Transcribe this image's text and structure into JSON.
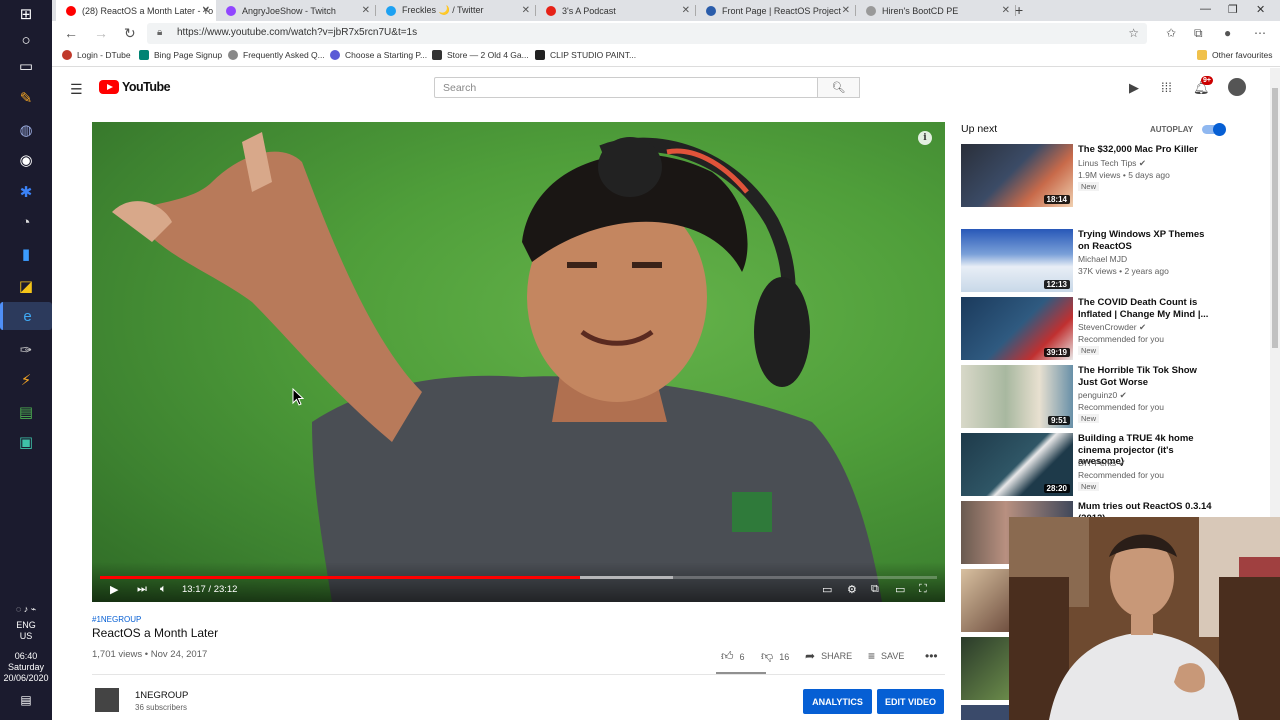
{
  "browser": {
    "tabs": [
      {
        "title": "(28) ReactOS a Month Later - Yo",
        "color": "#ff0000",
        "active": true
      },
      {
        "title": "AngryJoeShow - Twitch",
        "color": "#9146ff",
        "active": false
      },
      {
        "title": "Freckles 🌙 / Twitter",
        "color": "#1da1f2",
        "active": false
      },
      {
        "title": "3's A Podcast",
        "color": "#e62117",
        "active": false
      },
      {
        "title": "Front Page | ReactOS Project",
        "color": "#2a5caa",
        "active": false
      },
      {
        "title": "Hiren's BootCD PE",
        "color": "#999999",
        "active": false
      }
    ],
    "url": "https://www.youtube.com/watch?v=jbR7x5rcn7U&t=1s",
    "bookmarks": [
      {
        "label": "Login - DTube",
        "color": "#c0392b"
      },
      {
        "label": "Bing Page Signup",
        "color": "#008373"
      },
      {
        "label": "Frequently Asked Q...",
        "color": "#888888"
      },
      {
        "label": "Choose a Starting P...",
        "color": "#5b5bd6"
      },
      {
        "label": "Store — 2 Old 4 Ga...",
        "color": "#333333"
      },
      {
        "label": "CLIP STUDIO PAINT...",
        "color": "#222222"
      }
    ],
    "other_favourites": "Other favourites"
  },
  "taskbar": {
    "lang": "ENG",
    "region": "US",
    "time": "06:40",
    "day": "Saturday",
    "date": "20/06/2020"
  },
  "youtube": {
    "logo_text": "YouTube",
    "search_placeholder": "Search",
    "notification_count": "9+"
  },
  "player": {
    "timecode": "13:17 / 23:12",
    "played_fraction": 0.573,
    "buffered_fraction": 0.685
  },
  "video": {
    "hashtag": "#1NEGROUP",
    "title": "ReactOS a Month Later",
    "views_date": "1,701 views • Nov 24, 2017",
    "likes": "6",
    "dislikes": "16",
    "share_label": "SHARE",
    "save_label": "SAVE",
    "channel_name": "1NEGROUP",
    "channel_subs": "36 subscribers",
    "analytics_label": "ANALYTICS",
    "edit_label": "EDIT VIDEO"
  },
  "sidebar": {
    "up_next": "Up next",
    "autoplay": "AUTOPLAY",
    "items": [
      {
        "title": "The $32,000 Mac Pro Killer",
        "channel": "Linus Tech Tips",
        "meta": "1.9M views • 5 days ago",
        "badge": "New",
        "duration": "18:14",
        "verified": true
      },
      {
        "title": "Trying Windows XP Themes on ReactOS",
        "channel": "Michael MJD",
        "meta": "37K views • 2 years ago",
        "badge": "",
        "duration": "12:13",
        "verified": false
      },
      {
        "title": "The COVID Death Count is Inflated | Change My Mind |...",
        "channel": "StevenCrowder",
        "meta": "Recommended for you",
        "badge": "New",
        "duration": "39:19",
        "verified": true
      },
      {
        "title": "The Horrible Tik Tok Show Just Got Worse",
        "channel": "penguinz0",
        "meta": "Recommended for you",
        "badge": "New",
        "duration": "9:51",
        "verified": true
      },
      {
        "title": "Building a TRUE 4k home cinema projector (it's awesome)",
        "channel": "DIY Perks",
        "meta": "Recommended for you",
        "badge": "New",
        "duration": "28:20",
        "verified": true
      },
      {
        "title": "Mum tries out ReactOS 0.3.14 (2012)",
        "channel": "",
        "meta": "",
        "badge": "",
        "duration": "",
        "verified": false
      }
    ]
  }
}
